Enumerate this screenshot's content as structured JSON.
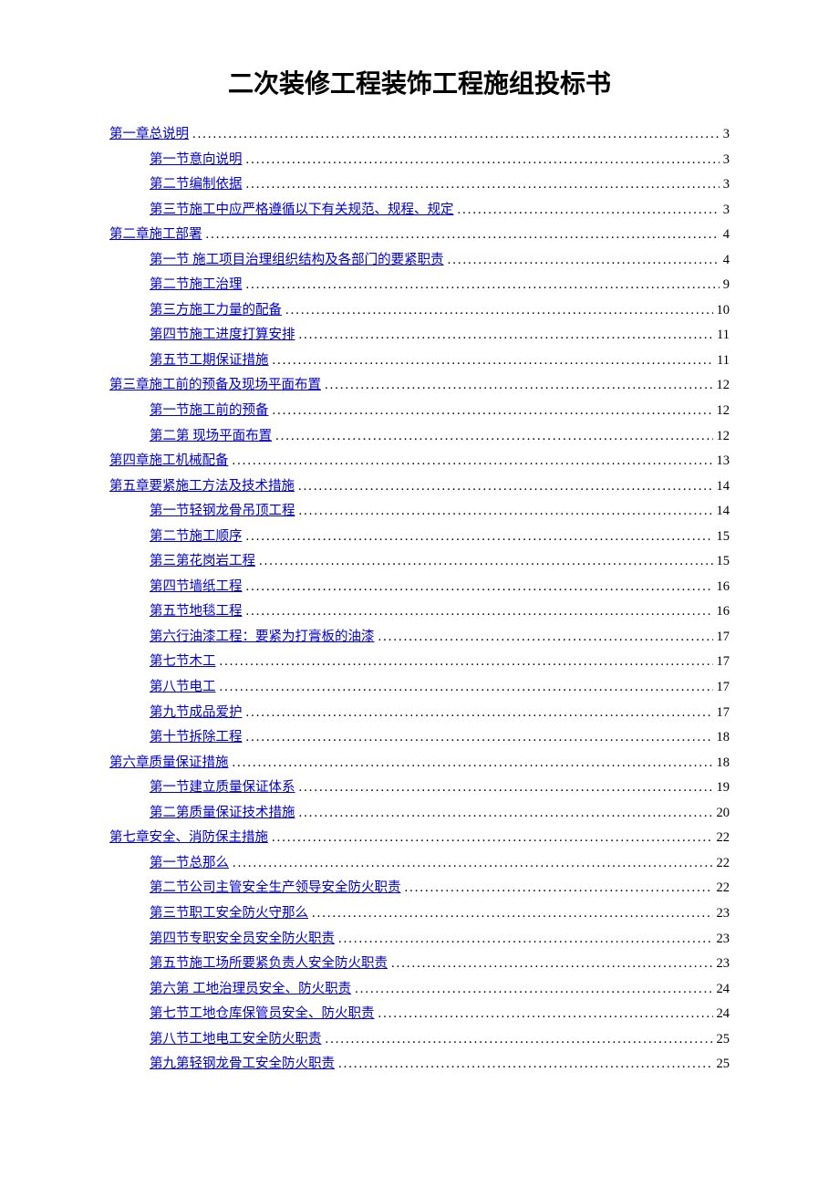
{
  "title": "二次装修工程装饰工程施组投标书",
  "toc": [
    {
      "level": 0,
      "label": "第一章总说明",
      "page": "3"
    },
    {
      "level": 1,
      "label": "第一节意向说明",
      "page": "3"
    },
    {
      "level": 1,
      "label": "第二节编制依据",
      "page": "3"
    },
    {
      "level": 1,
      "label": "第三节施工中应严格遵循以下有关规范、规程、规定",
      "page": "3"
    },
    {
      "level": 0,
      "label": "第二章施工部署",
      "page": "4"
    },
    {
      "level": 1,
      "label": "第一节  施工项目治理组织结构及各部门的要紧职责",
      "page": "4"
    },
    {
      "level": 1,
      "label": "第二节施工治理",
      "page": "9"
    },
    {
      "level": 1,
      "label": "第三方施工力量的配备",
      "page": "10"
    },
    {
      "level": 1,
      "label": "第四节施工进度打算安排",
      "page": "11"
    },
    {
      "level": 1,
      "label": "第五节工期保证措施",
      "page": "11"
    },
    {
      "level": 0,
      "label": "第三章施工前的预备及现场平面布置",
      "page": "12"
    },
    {
      "level": 1,
      "label": "第一节施工前的预备",
      "page": "12"
    },
    {
      "level": 1,
      "label": "第二第  现场平面布置",
      "page": "12"
    },
    {
      "level": 0,
      "label": "第四章施工机械配备",
      "page": "13"
    },
    {
      "level": 0,
      "label": "第五章要紧施工方法及技术措施",
      "page": "14"
    },
    {
      "level": 1,
      "label": "第一节轻钢龙骨吊顶工程",
      "page": "14"
    },
    {
      "level": 1,
      "label": "第二节施工顺序",
      "page": "15"
    },
    {
      "level": 1,
      "label": "第三第花岗岩工程",
      "page": "15"
    },
    {
      "level": 1,
      "label": "第四节墙纸工程",
      "page": "16"
    },
    {
      "level": 1,
      "label": "第五节地毯工程",
      "page": "16"
    },
    {
      "level": 1,
      "label": "第六行油漆工程：要紧为打膏板的油漆",
      "page": "17"
    },
    {
      "level": 1,
      "label": "第七节木工",
      "page": "17"
    },
    {
      "level": 1,
      "label": "第八节电工",
      "page": "17"
    },
    {
      "level": 1,
      "label": "第九节成品爱护",
      "page": "17"
    },
    {
      "level": 1,
      "label": "第十节拆除工程",
      "page": "18"
    },
    {
      "level": 0,
      "label": "第六章质量保证措施",
      "page": "18"
    },
    {
      "level": 1,
      "label": "第一节建立质量保证体系",
      "page": "19"
    },
    {
      "level": 1,
      "label": "第二第质量保证技术措施",
      "page": "20"
    },
    {
      "level": 0,
      "label": "第七章安全、消防保主措施",
      "page": "22"
    },
    {
      "level": 1,
      "label": "第一节总那么",
      "page": "22"
    },
    {
      "level": 1,
      "label": "第二节公司主管安全生产领导安全防火职责",
      "page": "22"
    },
    {
      "level": 1,
      "label": "第三节职工安全防火守那么",
      "page": "23"
    },
    {
      "level": 1,
      "label": "第四节专职安全员安全防火职责",
      "page": "23"
    },
    {
      "level": 1,
      "label": "第五节施工场所要紧负责人安全防火职责",
      "page": "23"
    },
    {
      "level": 1,
      "label": "第六第  工地治理员安全、防火职责",
      "page": "24"
    },
    {
      "level": 1,
      "label": "第七节工地仓库保管员安全、防火职责",
      "page": "24"
    },
    {
      "level": 1,
      "label": "第八节工地电工安全防火职责",
      "page": "25"
    },
    {
      "level": 1,
      "label": "第九第轻钢龙骨工安全防火职责",
      "page": "25"
    }
  ]
}
